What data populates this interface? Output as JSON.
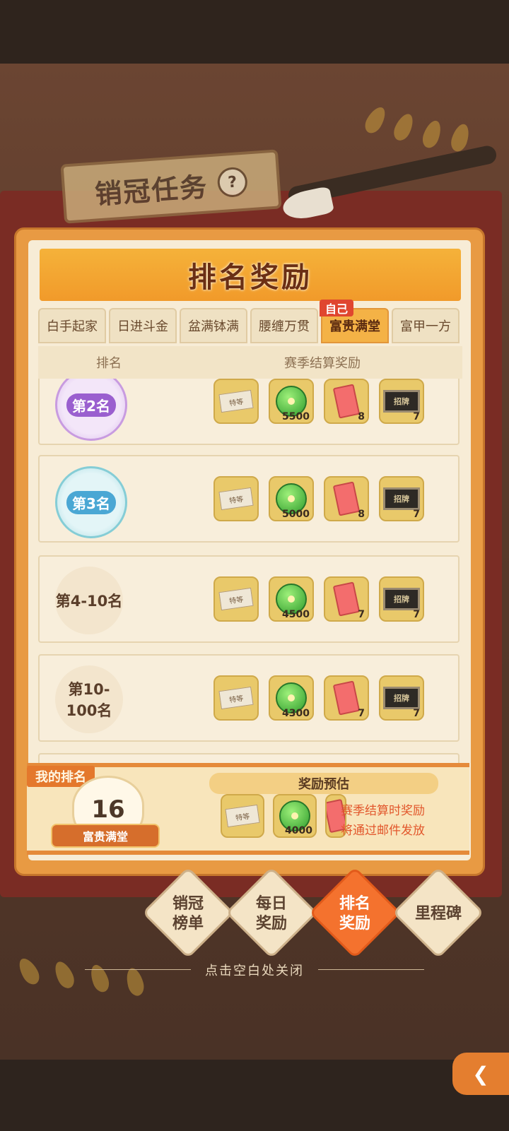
{
  "header": {
    "quest_title": "销冠任务",
    "help": "?"
  },
  "panel": {
    "title": "排名奖励"
  },
  "tabs": [
    {
      "label": "白手起家"
    },
    {
      "label": "日进斗金"
    },
    {
      "label": "盆满钵满"
    },
    {
      "label": "腰缠万贯"
    },
    {
      "label": "富贵满堂",
      "active": true,
      "badge": "自己"
    },
    {
      "label": "富甲一方"
    }
  ],
  "columns": {
    "rank": "排名",
    "reward": "赛季结算奖励"
  },
  "rows": [
    {
      "rank": "第2名",
      "items": [
        {
          "icon": "ticket-icon",
          "label": "特等",
          "qty": ""
        },
        {
          "icon": "green-coin-icon",
          "qty": "5500"
        },
        {
          "icon": "red-envelope-icon",
          "qty": "8"
        },
        {
          "icon": "plaque-icon",
          "label": "招牌",
          "qty": "7"
        }
      ]
    },
    {
      "rank": "第3名",
      "items": [
        {
          "icon": "ticket-icon",
          "label": "特等",
          "qty": ""
        },
        {
          "icon": "green-coin-icon",
          "qty": "5000"
        },
        {
          "icon": "red-envelope-icon",
          "qty": "8"
        },
        {
          "icon": "plaque-icon",
          "label": "招牌",
          "qty": "7"
        }
      ]
    },
    {
      "rank": "第4-10名",
      "items": [
        {
          "icon": "ticket-icon",
          "label": "特等",
          "qty": ""
        },
        {
          "icon": "green-coin-icon",
          "qty": "4500"
        },
        {
          "icon": "red-envelope-icon",
          "qty": "7"
        },
        {
          "icon": "plaque-icon",
          "label": "招牌",
          "qty": "7"
        }
      ]
    },
    {
      "rank": "第10-100名",
      "items": [
        {
          "icon": "ticket-icon",
          "label": "特等",
          "qty": ""
        },
        {
          "icon": "green-coin-icon",
          "qty": "4300"
        },
        {
          "icon": "red-envelope-icon",
          "qty": "7"
        },
        {
          "icon": "plaque-icon",
          "label": "招牌",
          "qty": "7"
        }
      ]
    }
  ],
  "my_rank": {
    "label": "我的排名",
    "value": "16",
    "title": "富贵满堂",
    "estimate_header": "奖励预估",
    "estimate_items": [
      {
        "icon": "ticket-icon",
        "label": "特等",
        "qty": ""
      },
      {
        "icon": "green-coin-icon",
        "qty": "4000"
      },
      {
        "icon": "red-envelope-icon",
        "qty": ""
      }
    ],
    "note_line1": "赛季结算时奖励",
    "note_line2": "将通过邮件发放"
  },
  "nav": [
    {
      "label": "销冠\n榜单"
    },
    {
      "label": "每日\n奖励"
    },
    {
      "label": "排名\n奖励",
      "active": true
    },
    {
      "label": "里程碑"
    }
  ],
  "hint": "点击空白处关闭"
}
